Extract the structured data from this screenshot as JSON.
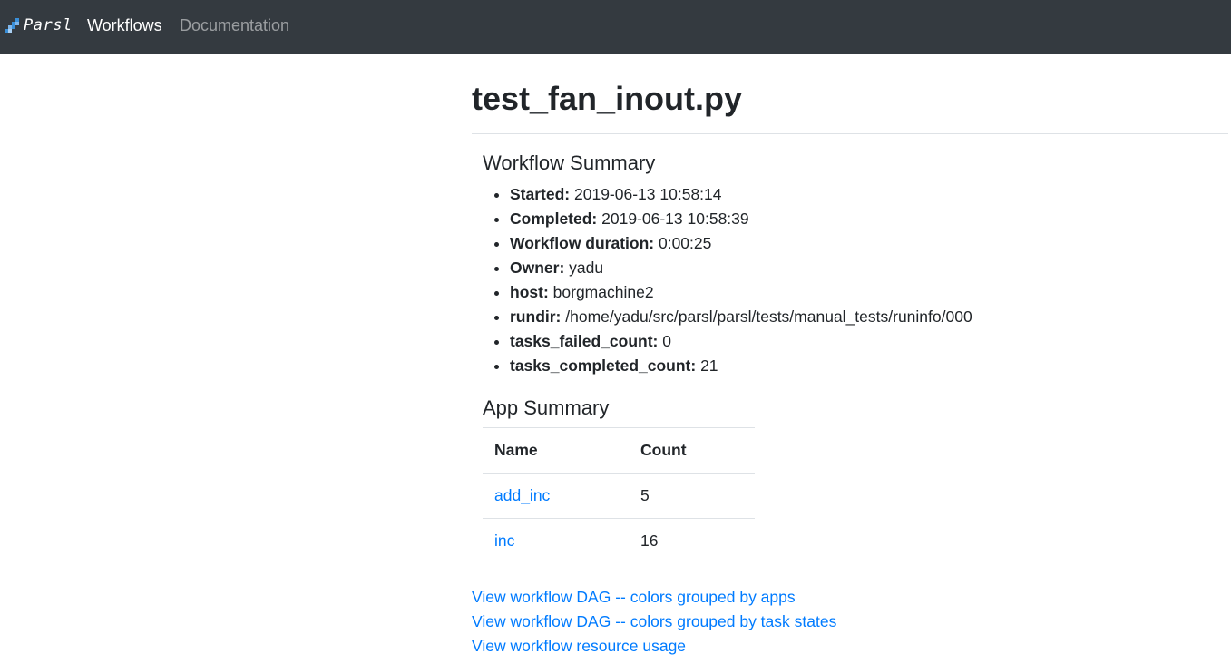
{
  "navbar": {
    "brand": "Parsl",
    "links": [
      {
        "label": "Workflows",
        "active": true
      },
      {
        "label": "Documentation",
        "active": false
      }
    ]
  },
  "page": {
    "title": "test_fan_inout.py"
  },
  "workflow_summary": {
    "title": "Workflow Summary",
    "items": [
      {
        "key": "Started:",
        "value": "2019-06-13 10:58:14"
      },
      {
        "key": "Completed:",
        "value": "2019-06-13 10:58:39"
      },
      {
        "key": "Workflow duration:",
        "value": "0:00:25"
      },
      {
        "key": "Owner:",
        "value": "yadu"
      },
      {
        "key": "host:",
        "value": "borgmachine2"
      },
      {
        "key": "rundir:",
        "value": "/home/yadu/src/parsl/parsl/tests/manual_tests/runinfo/000"
      },
      {
        "key": "tasks_failed_count:",
        "value": "0"
      },
      {
        "key": "tasks_completed_count:",
        "value": "21"
      }
    ]
  },
  "app_summary": {
    "title": "App Summary",
    "columns": [
      "Name",
      "Count"
    ],
    "rows": [
      {
        "name": "add_inc",
        "count": "5"
      },
      {
        "name": "inc",
        "count": "16"
      }
    ]
  },
  "links": [
    "View workflow DAG -- colors grouped by apps",
    "View workflow DAG -- colors grouped by task states",
    "View workflow resource usage"
  ],
  "colors": {
    "navbar_bg": "#343a40",
    "link": "#007bff",
    "text": "#212529",
    "brand_blue": "#3a8fd8"
  }
}
